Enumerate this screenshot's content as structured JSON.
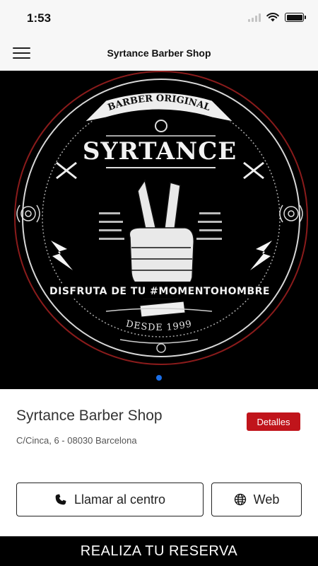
{
  "status_bar": {
    "time": "1:53"
  },
  "nav": {
    "title": "Syrtance Barber Shop",
    "menu_icon": "hamburger-menu-icon"
  },
  "hero": {
    "logo": {
      "banner_text": "BARBER ORIGINAL",
      "brand": "SYRTANCE",
      "tagline": "DISFRUTA DE TU #MOMENTOHOMBRE",
      "since": "DESDE 1999"
    },
    "page_count": 1,
    "active_page": 1
  },
  "shop": {
    "name": "Syrtance Barber Shop",
    "address": "C/Cinca, 6 - 08030 Barcelona",
    "details_label": "Detalles"
  },
  "actions": {
    "call_label": "Llamar al centro",
    "call_icon": "phone-icon",
    "web_label": "Web",
    "web_icon": "globe-icon"
  },
  "reserve": {
    "label": "REALIZA TU RESERVA"
  },
  "colors": {
    "accent_red": "#c0141b",
    "page_dot_blue": "#1b6fe8",
    "hero_background": "#000000"
  }
}
